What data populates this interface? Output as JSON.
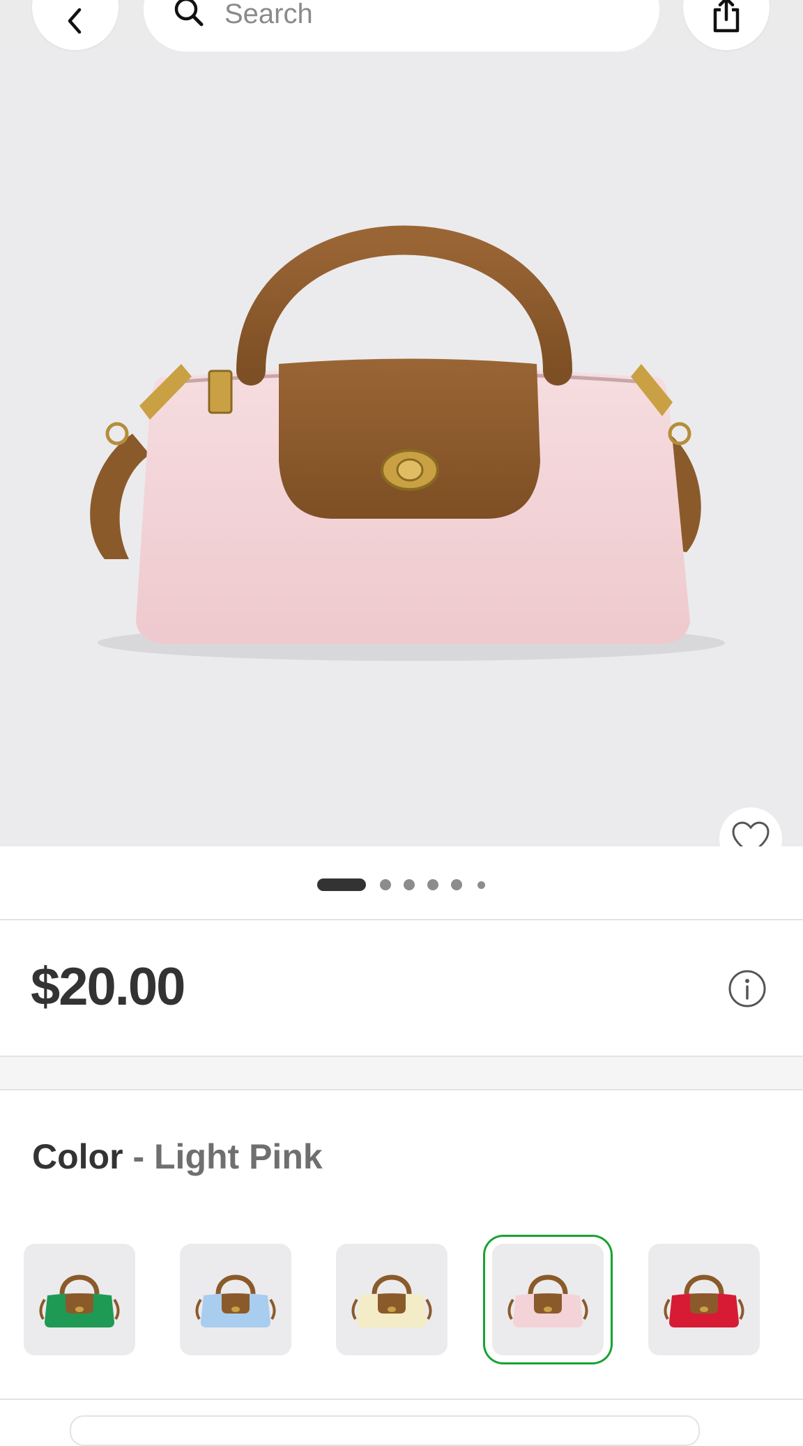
{
  "search": {
    "placeholder": "Search"
  },
  "gallery": {
    "image_count": 6,
    "active_index": 0
  },
  "product": {
    "price": "$20.00"
  },
  "variant": {
    "label": "Color",
    "separator": "-",
    "selected": "Light Pink",
    "swatches": [
      {
        "color": "#1f9a55",
        "selected": false
      },
      {
        "color": "#a9cdef",
        "selected": false
      },
      {
        "color": "#f4ecc6",
        "selected": false
      },
      {
        "color": "#f4d3d8",
        "selected": true
      },
      {
        "color": "#d81b35",
        "selected": false
      }
    ]
  },
  "colors": {
    "accent_selected": "#17a233",
    "leather": "#8b5a2b",
    "hero_background": "#ebebed",
    "bag_body": "#f2d2d6"
  },
  "icons": {
    "back": "chevron-left-icon",
    "search": "search-icon",
    "share": "share-icon",
    "favorite": "heart-outline-icon",
    "info": "info-circle-icon"
  }
}
